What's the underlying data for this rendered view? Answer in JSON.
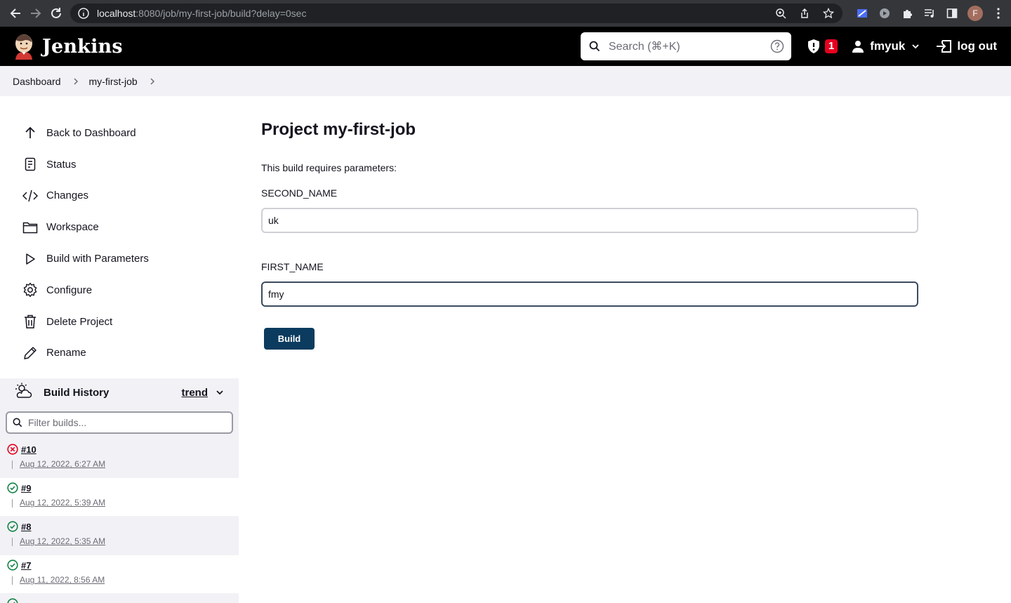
{
  "browser": {
    "url_host": "localhost",
    "url_path": ":8080/job/my-first-job/build?delay=0sec",
    "profile_initial": "F"
  },
  "header": {
    "brand": "Jenkins",
    "search_placeholder": "Search (⌘+K)",
    "security_count": "1",
    "username": "fmyuk",
    "logout_label": "log out"
  },
  "breadcrumb": {
    "items": [
      "Dashboard",
      "my-first-job"
    ]
  },
  "sidebar": {
    "tasks": [
      {
        "label": "Back to Dashboard",
        "icon": "arrow-up-icon"
      },
      {
        "label": "Status",
        "icon": "document-icon"
      },
      {
        "label": "Changes",
        "icon": "code-icon"
      },
      {
        "label": "Workspace",
        "icon": "folder-icon"
      },
      {
        "label": "Build with Parameters",
        "icon": "play-icon"
      },
      {
        "label": "Configure",
        "icon": "gear-icon"
      },
      {
        "label": "Delete Project",
        "icon": "trash-icon"
      },
      {
        "label": "Rename",
        "icon": "pencil-icon"
      }
    ]
  },
  "build_history": {
    "title": "Build History",
    "trend_label": "trend",
    "filter_placeholder": "Filter builds...",
    "builds": [
      {
        "number": "#10",
        "date": "Aug 12, 2022, 6:27 AM",
        "status": "failed"
      },
      {
        "number": "#9",
        "date": "Aug 12, 2022, 5:39 AM",
        "status": "success"
      },
      {
        "number": "#8",
        "date": "Aug 12, 2022, 5:35 AM",
        "status": "success"
      },
      {
        "number": "#7",
        "date": "Aug 11, 2022, 8:56 AM",
        "status": "success"
      }
    ]
  },
  "main": {
    "title": "Project my-first-job",
    "description": "This build requires parameters:",
    "params": [
      {
        "name": "SECOND_NAME",
        "value": "uk"
      },
      {
        "name": "FIRST_NAME",
        "value": "fmy"
      }
    ],
    "build_button": "Build"
  },
  "colors": {
    "header_bg": "#000000",
    "breadcrumb_bg": "#f2f2f6",
    "build_button": "#0b3b5e",
    "badge": "#e6001f",
    "success": "#138347",
    "failure": "#e6001f"
  }
}
